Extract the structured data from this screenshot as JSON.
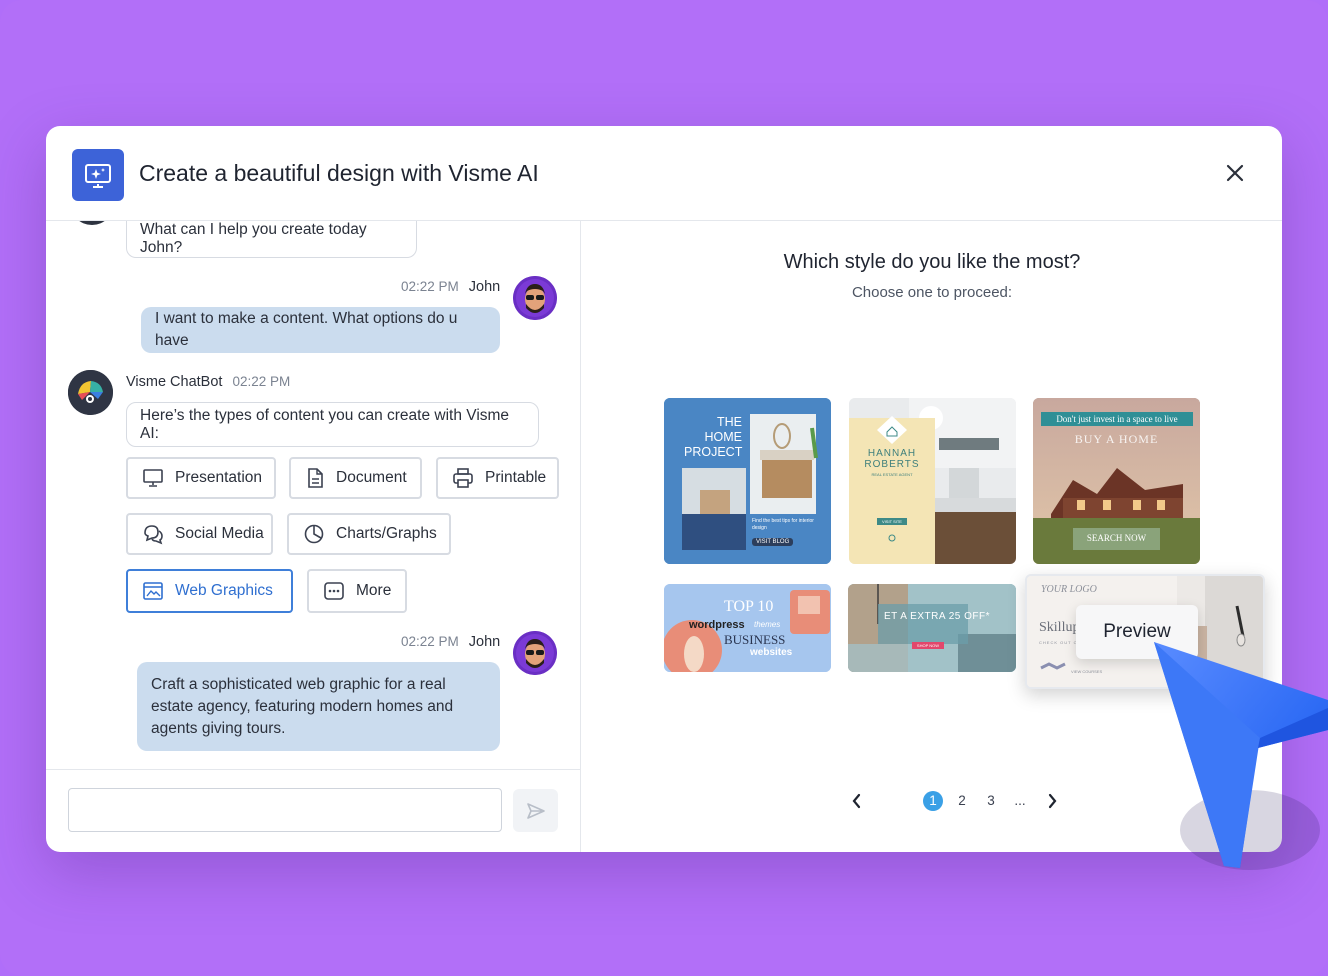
{
  "modal": {
    "title": "Create a beautiful design with Visme AI",
    "close_icon": "close-icon",
    "header_icon": "ai-sparkle-screen-icon"
  },
  "chat": {
    "greeting": "What can I help you create today John?",
    "messages": [
      {
        "time": "02:22 PM",
        "author": "John",
        "text": "I want to make a content. What options do u have"
      },
      {
        "time": "02:22 PM",
        "author": "Visme ChatBot",
        "text": "Here’s the types of content you can create with Visme AI:"
      },
      {
        "time": "02:22 PM",
        "author": "John",
        "text": "Craft a sophisticated web graphic for a real estate agency, featuring modern homes and agents giving tours."
      }
    ],
    "options": [
      {
        "label": "Presentation",
        "icon": "presentation-icon"
      },
      {
        "label": "Document",
        "icon": "document-icon"
      },
      {
        "label": "Printable",
        "icon": "printer-icon"
      },
      {
        "label": "Social Media",
        "icon": "chat-bubbles-icon"
      },
      {
        "label": "Charts/Graphs",
        "icon": "pie-chart-icon"
      },
      {
        "label": "Web Graphics",
        "icon": "web-graphics-icon",
        "selected": true
      },
      {
        "label": "More",
        "icon": "more-dots-icon"
      }
    ],
    "input_value": "",
    "send_icon": "send-icon"
  },
  "styles": {
    "title": "Which style do you like the most?",
    "subtitle": "Choose one to proceed:",
    "cards": [
      {
        "lines": [
          "THE",
          "HOME",
          "PROJECT"
        ],
        "button": "VISIT BLOG",
        "caption": "Find the best tips for interior design"
      },
      {
        "lines": [
          "HANNAH",
          "ROBERTS"
        ],
        "tag": "REAL ESTATE AGENT",
        "button": "VISIT SITE"
      },
      {
        "banner": "Don't just invest in a space to live",
        "headline": "BUY A HOME",
        "button": "SEARCH NOW"
      },
      {
        "lines": [
          "TOP 10",
          "wordpress",
          "themes",
          "BUSINESS",
          "websites"
        ]
      },
      {
        "headline": "ET A EXTRA 25 OFF*",
        "button": "SHOP NOW"
      },
      {
        "logo": "YOUR LOGO",
        "headline": "Skillup",
        "caption": "CHECK OUT O",
        "button": "VIEW COURSES"
      }
    ],
    "preview_label": "Preview",
    "pagination": {
      "pages": [
        "1",
        "2",
        "3",
        "..."
      ],
      "current": "1",
      "prev_icon": "chevron-left-icon",
      "next_icon": "chevron-right-icon"
    }
  },
  "colors": {
    "background": "#b26ff8",
    "accent": "#3d63d8",
    "user_bubble": "#cbdcee",
    "selected": "#3f7fd9",
    "cursor": "#2f6cf5"
  }
}
